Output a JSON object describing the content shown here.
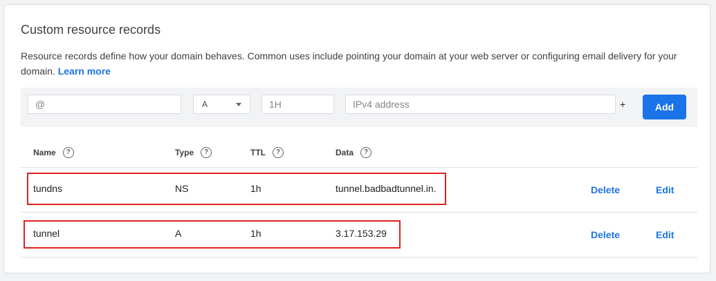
{
  "section": {
    "title": "Custom resource records",
    "description": "Resource records define how your domain behaves. Common uses include pointing your domain at your web server or configuring email delivery for your domain.",
    "learn_more": "Learn more"
  },
  "form": {
    "name_value": "@",
    "type_value": "A",
    "ttl_value": "1H",
    "data_placeholder": "IPv4 address",
    "plus_label": "+",
    "add_label": "Add"
  },
  "table": {
    "headers": [
      "Name",
      "Type",
      "TTL",
      "Data"
    ],
    "help_glyph": "?",
    "rows": [
      {
        "name": "tundns",
        "type": "NS",
        "ttl": "1h",
        "data": "tunnel.badbadtunnel.in.",
        "delete": "Delete",
        "edit": "Edit"
      },
      {
        "name": "tunnel",
        "type": "A",
        "ttl": "1h",
        "data": "3.17.153.29",
        "delete": "Delete",
        "edit": "Edit"
      }
    ]
  },
  "colors": {
    "accent": "#1a73e8",
    "highlight": "#e0201e"
  }
}
